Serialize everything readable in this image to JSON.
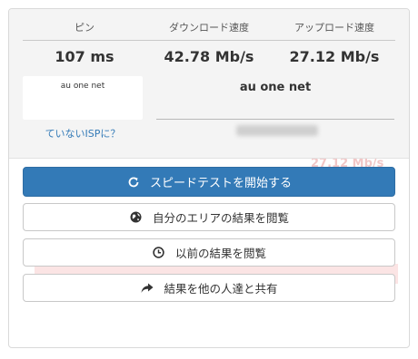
{
  "results": {
    "ping": {
      "label": "ピン",
      "value": "107 ms"
    },
    "download": {
      "label": "ダウンロード速度",
      "value": "42.78 Mb/s"
    },
    "upload": {
      "label": "アップロード速度",
      "value": "27.12 Mb/s"
    }
  },
  "isp": {
    "logo_text": "au one net",
    "not_your_isp_link": "ていないISPに？",
    "name": "au one net"
  },
  "background": {
    "faded_speed": "27.12 Mb/s"
  },
  "buttons": {
    "start_test": "スピードテストを開始する",
    "view_area_results": "自分のエリアの結果を閲覧",
    "view_previous_results": "以前の結果を閲覧",
    "share_results": "結果を他の人達と共有"
  },
  "colors": {
    "primary": "#337ab7",
    "link": "#337ab7"
  },
  "icons": {
    "start_test": "refresh-icon",
    "area_results": "globe-icon",
    "previous_results": "clock-icon",
    "share": "share-arrow-icon"
  }
}
